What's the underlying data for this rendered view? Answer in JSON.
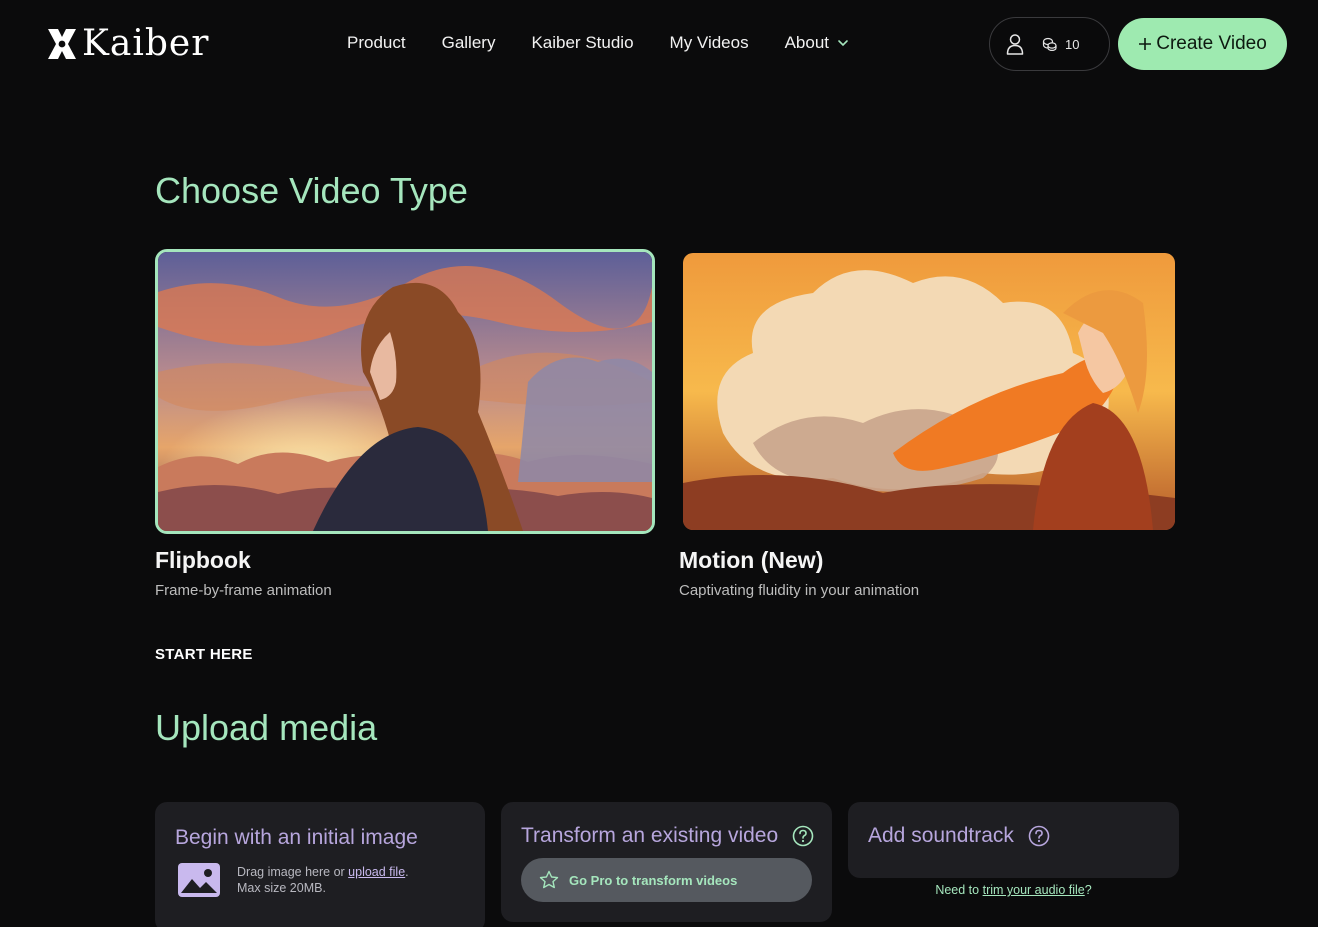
{
  "header": {
    "logo_text": "Kaiber",
    "nav": [
      {
        "label": "Product"
      },
      {
        "label": "Gallery"
      },
      {
        "label": "Kaiber Studio"
      },
      {
        "label": "My Videos"
      },
      {
        "label": "About",
        "icon": "chevron-down-icon"
      }
    ],
    "credits": "10",
    "create_label": "Create Video",
    "accent_color": "#9eeab0"
  },
  "video_type": {
    "title": "Choose Video Type",
    "options": [
      {
        "title": "Flipbook",
        "subtitle": "Frame-by-frame animation",
        "selected": true
      },
      {
        "title": "Motion (New)",
        "subtitle": "Captivating fluidity in your animation",
        "selected": false
      }
    ],
    "start_here": "START HERE"
  },
  "upload": {
    "title": "Upload media",
    "image_panel": {
      "title": "Begin with an initial image",
      "drag_text": "Drag image here or ",
      "link_text": "upload file",
      "after_link": ".",
      "max_size": "Max size 20MB."
    },
    "video_panel": {
      "title": "Transform an existing video",
      "pro_label": "Go Pro to transform videos"
    },
    "sound_panel": {
      "title": "Add soundtrack",
      "note_prefix": "Need to ",
      "note_link": "trim your audio file",
      "note_suffix": "?"
    }
  }
}
